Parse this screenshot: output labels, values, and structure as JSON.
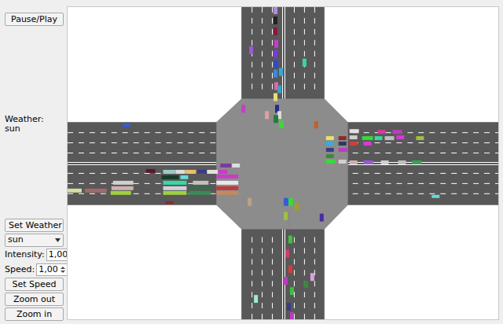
{
  "controls": {
    "pause_button": "Pause/Play",
    "weather_label": "Weather:",
    "weather_value": "sun",
    "set_weather_button": "Set Weather",
    "weather_select": "sun",
    "intensity": {
      "label": "Intensity:",
      "value": "1,00"
    },
    "speed": {
      "label": "Speed:",
      "value": "1,00"
    },
    "set_speed_button": "Set Speed",
    "zoom_out_button": "Zoom out",
    "zoom_in_button": "Zoom in"
  }
}
